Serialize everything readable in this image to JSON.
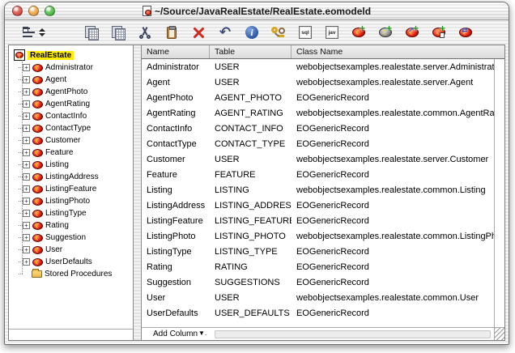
{
  "window": {
    "title": "~/Source/JavaRealEstate/RealEstate.eomodeld"
  },
  "colors": {
    "close_button": "#e2463d",
    "minimize_button": "#f5a73c",
    "zoom_button": "#49c03f",
    "selection_yellow": "#ffec00",
    "entity_red": "#dd1a0c",
    "add_plus_green": "#1f9a1f",
    "delete_red": "#cf2b23",
    "info_blue": "#2a55a8"
  },
  "toolbar": {
    "sql_glyph": "sql",
    "jav_glyph": "jav",
    "undo_glyph": "↶",
    "info_glyph": "i",
    "plus_glyph": "+",
    "rel_arrow_glyph": "↗",
    "flatten_arrow_glyph": "⇄",
    "expander_glyph": "+",
    "icon_names": [
      "outline-view-selector",
      "copy",
      "duplicate",
      "cut",
      "paste",
      "delete",
      "undo",
      "inspector-info",
      "browse-key",
      "generate-sql",
      "java-browser",
      "add-entity",
      "add-attribute",
      "add-relationship",
      "add-fetch-spec",
      "add-flattened-relationship"
    ]
  },
  "sidebar": {
    "root_label": "RealEstate",
    "entities": [
      "Administrator",
      "Agent",
      "AgentPhoto",
      "AgentRating",
      "ContactInfo",
      "ContactType",
      "Customer",
      "Feature",
      "Listing",
      "ListingAddress",
      "ListingFeature",
      "ListingPhoto",
      "ListingType",
      "Rating",
      "Suggestion",
      "User",
      "UserDefaults"
    ],
    "stored_procedures_label": "Stored Procedures"
  },
  "table": {
    "columns": [
      "Name",
      "Table",
      "Class Name"
    ],
    "rows": [
      {
        "name": "Administrator",
        "table": "USER",
        "class_name": "webobjectsexamples.realestate.server.Administrator"
      },
      {
        "name": "Agent",
        "table": "USER",
        "class_name": "webobjectsexamples.realestate.server.Agent"
      },
      {
        "name": "AgentPhoto",
        "table": "AGENT_PHOTO",
        "class_name": "EOGenericRecord"
      },
      {
        "name": "AgentRating",
        "table": "AGENT_RATING",
        "class_name": "webobjectsexamples.realestate.common.AgentRating"
      },
      {
        "name": "ContactInfo",
        "table": "CONTACT_INFO",
        "class_name": "EOGenericRecord"
      },
      {
        "name": "ContactType",
        "table": "CONTACT_TYPE",
        "class_name": "EOGenericRecord"
      },
      {
        "name": "Customer",
        "table": "USER",
        "class_name": "webobjectsexamples.realestate.server.Customer"
      },
      {
        "name": "Feature",
        "table": "FEATURE",
        "class_name": "EOGenericRecord"
      },
      {
        "name": "Listing",
        "table": "LISTING",
        "class_name": "webobjectsexamples.realestate.common.Listing"
      },
      {
        "name": "ListingAddress",
        "table": "LISTING_ADDRESS",
        "class_name": "EOGenericRecord"
      },
      {
        "name": "ListingFeature",
        "table": "LISTING_FEATURE",
        "class_name": "EOGenericRecord"
      },
      {
        "name": "ListingPhoto",
        "table": "LISTING_PHOTO",
        "class_name": "webobjectsexamples.realestate.common.ListingPhoto"
      },
      {
        "name": "ListingType",
        "table": "LISTING_TYPE",
        "class_name": "EOGenericRecord"
      },
      {
        "name": "Rating",
        "table": "RATING",
        "class_name": "EOGenericRecord"
      },
      {
        "name": "Suggestion",
        "table": "SUGGESTIONS",
        "class_name": "EOGenericRecord"
      },
      {
        "name": "User",
        "table": "USER",
        "class_name": "webobjectsexamples.realestate.common.User"
      },
      {
        "name": "UserDefaults",
        "table": "USER_DEFAULTS",
        "class_name": "EOGenericRecord"
      }
    ]
  },
  "footer": {
    "add_column_label": "Add Column",
    "dropdown_glyph": "▼."
  }
}
